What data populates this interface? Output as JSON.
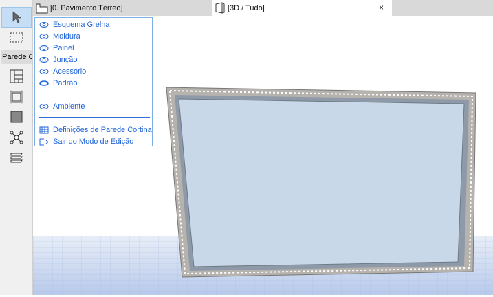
{
  "toolbox": {
    "group_label": "Parede C"
  },
  "tabs": [
    {
      "label": "[0. Pavimento Térreo]"
    },
    {
      "label": "[3D / Tudo]",
      "close": "×"
    }
  ],
  "menu": {
    "items": [
      {
        "label": "Esquema Grelha",
        "icon": "eye-icon"
      },
      {
        "label": "Moldura",
        "icon": "eye-icon"
      },
      {
        "label": "Painel",
        "icon": "eye-icon"
      },
      {
        "label": "Junção",
        "icon": "eye-icon"
      },
      {
        "label": "Acessório",
        "icon": "eye-icon"
      },
      {
        "label": "Padrão",
        "icon": "eye-closed-icon"
      }
    ],
    "ambient": {
      "label": "Ambiente",
      "icon": "eye-icon"
    },
    "settings": {
      "label": "Definições de Parede Cortina",
      "icon": "grid-settings-icon"
    },
    "exit": {
      "label": "Sair do Modo de Edição",
      "icon": "exit-icon"
    }
  },
  "colors": {
    "accent": "#1f63d8",
    "glass": "#c8d8e8",
    "frame": "#8e9aa8"
  }
}
